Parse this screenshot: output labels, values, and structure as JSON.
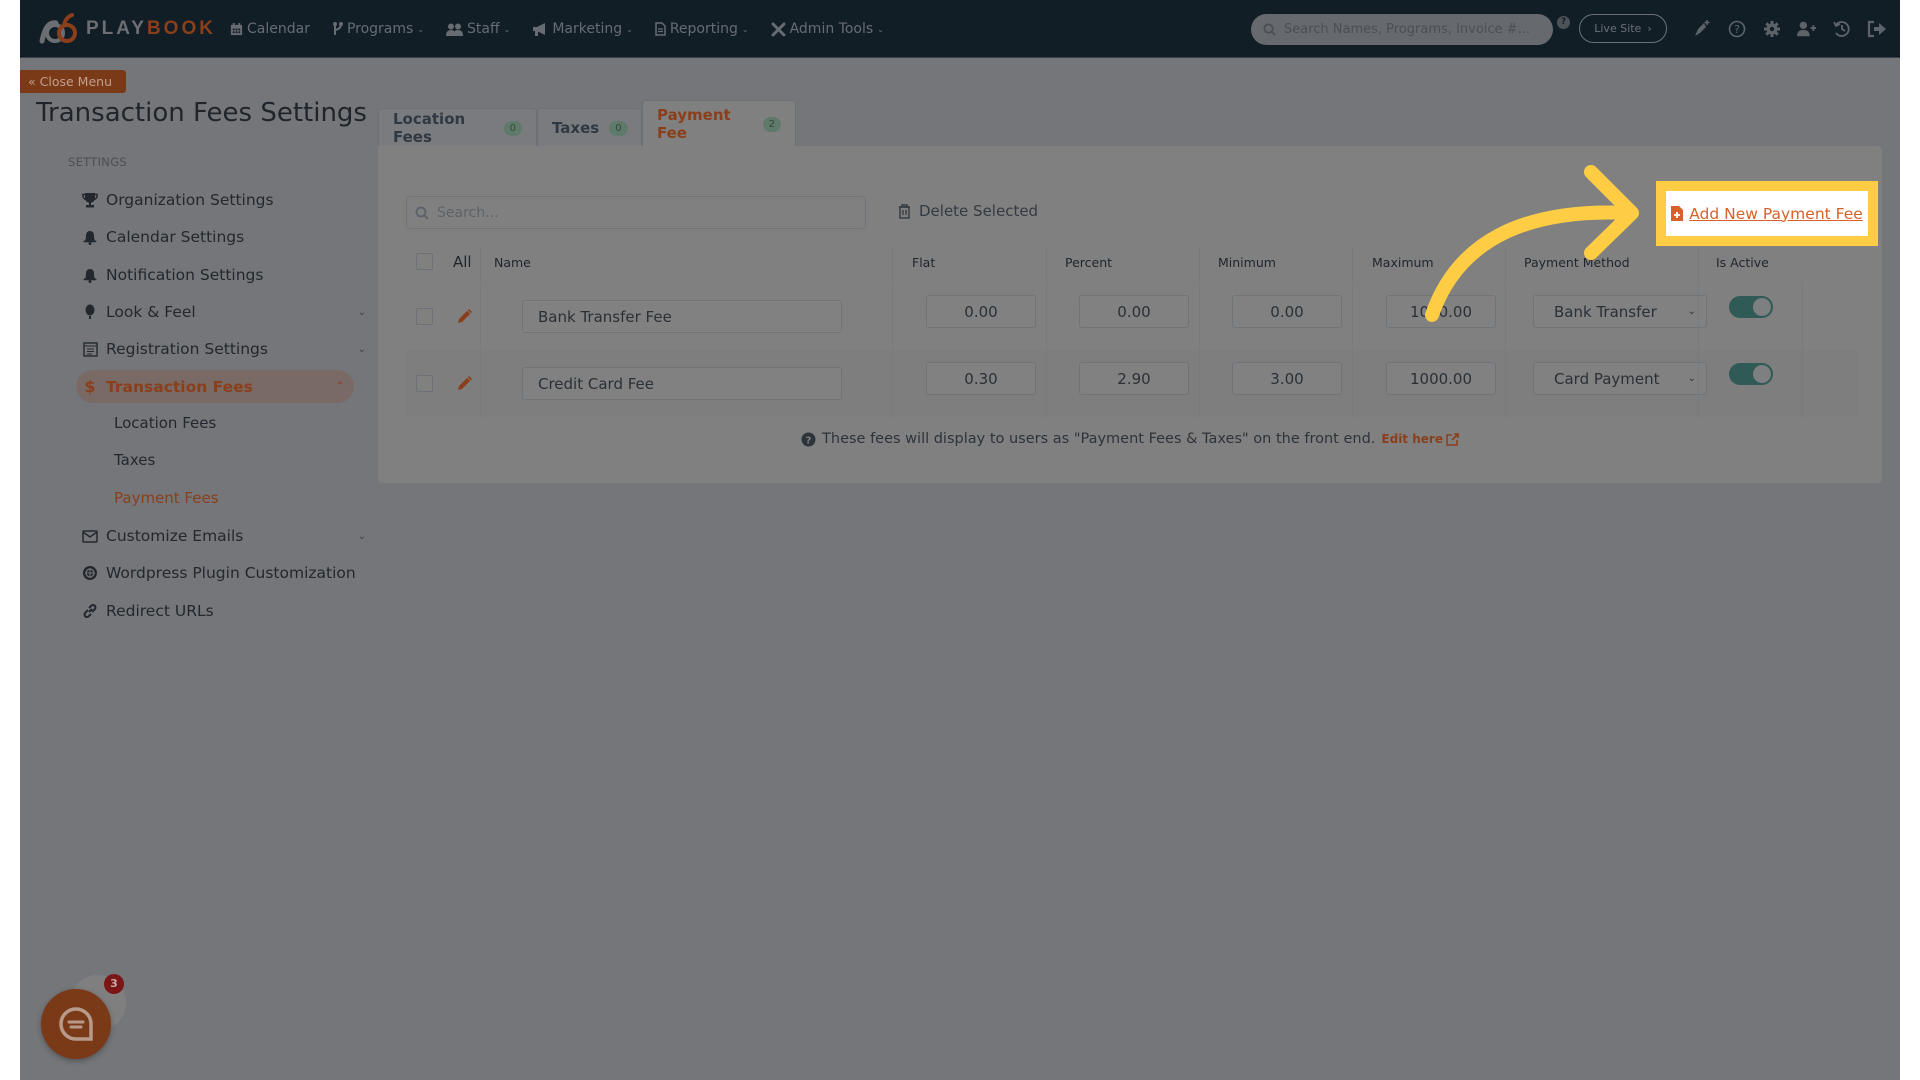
{
  "nav": {
    "logo_text_a": "PLAY",
    "logo_text_b": "BOOK",
    "items": [
      {
        "label": "Calendar",
        "icon": "calendar-icon",
        "dropdown": false
      },
      {
        "label": "Programs",
        "icon": "branch-icon",
        "dropdown": true
      },
      {
        "label": "Staff",
        "icon": "users-icon",
        "dropdown": true
      },
      {
        "label": "Marketing",
        "icon": "megaphone-icon",
        "dropdown": true
      },
      {
        "label": "Reporting",
        "icon": "file-icon",
        "dropdown": true
      },
      {
        "label": "Admin Tools",
        "icon": "tools-icon",
        "dropdown": true
      }
    ],
    "search_placeholder": "Search Names, Programs, Invoice #...",
    "live_site_label": "Live Site",
    "right_icons": [
      "rocket-icon",
      "help-icon",
      "gear-icon",
      "add-user-icon",
      "history-icon",
      "logout-icon"
    ]
  },
  "close_menu_label": "Close Menu",
  "page_title": "Transaction Fees Settings",
  "sidebar": {
    "section_label": "SETTINGS",
    "items": [
      {
        "label": "Organization Settings",
        "icon": "trophy-icon"
      },
      {
        "label": "Calendar Settings",
        "icon": "bell-icon"
      },
      {
        "label": "Notification Settings",
        "icon": "bell-icon"
      },
      {
        "label": "Look & Feel",
        "icon": "balloon-icon",
        "expandable": true
      },
      {
        "label": "Registration Settings",
        "icon": "registration-icon",
        "expandable": true
      },
      {
        "label": "Transaction Fees",
        "icon": "dollar-icon",
        "expandable": true,
        "active": true
      },
      {
        "label": "Customize Emails",
        "icon": "envelope-icon",
        "expandable": true
      },
      {
        "label": "Wordpress Plugin Customization",
        "icon": "wordpress-icon"
      },
      {
        "label": "Redirect URLs",
        "icon": "link-icon"
      }
    ],
    "sub_items": [
      {
        "label": "Location Fees"
      },
      {
        "label": "Taxes"
      },
      {
        "label": "Payment Fees",
        "active": true
      }
    ]
  },
  "tabs": [
    {
      "label": "Location Fees",
      "count": "0"
    },
    {
      "label": "Taxes",
      "count": "0"
    },
    {
      "label": "Payment Fee",
      "count": "2",
      "active": true
    }
  ],
  "toolbar": {
    "search_placeholder": "Search...",
    "delete_label": "Delete Selected",
    "add_label": "Add New Payment Fee"
  },
  "table": {
    "headers": {
      "all": "All",
      "name": "Name",
      "flat": "Flat",
      "percent": "Percent",
      "minimum": "Minimum",
      "maximum": "Maximum",
      "payment_method": "Payment Method",
      "is_active": "Is Active"
    },
    "rows": [
      {
        "name": "Bank Transfer Fee",
        "flat": "0.00",
        "percent": "0.00",
        "minimum": "0.00",
        "maximum": "1000.00",
        "payment_method": "Bank Transfer",
        "is_active": true
      },
      {
        "name": "Credit Card Fee",
        "flat": "0.30",
        "percent": "2.90",
        "minimum": "3.00",
        "maximum": "1000.00",
        "payment_method": "Card Payment",
        "is_active": true
      }
    ]
  },
  "note": {
    "text": "These fees will display to users as \"Payment Fees & Taxes\" on the front end.",
    "link": "Edit here"
  },
  "chat": {
    "badge_count": "3"
  },
  "colors": {
    "accent": "#8a3f1a",
    "highlight": "#fecd43",
    "link": "#d8612a",
    "toggle_on": "#2f5a55"
  }
}
